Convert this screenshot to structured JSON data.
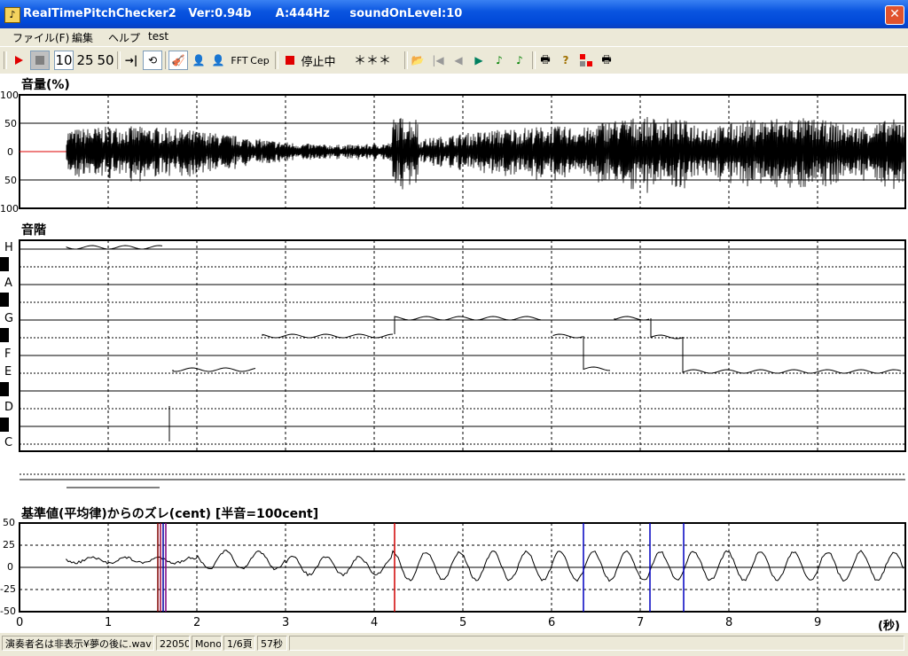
{
  "window": {
    "title": "RealTimePitchChecker2   Ver:0.94b      A:444Hz     soundOnLevel:10",
    "close_icon": "close-icon"
  },
  "menu": [
    "ファイル(F)",
    "編集",
    "ヘルプ",
    "test"
  ],
  "toolbar": {
    "play": "play-icon",
    "stop": "stop-icon",
    "speed_options": [
      "10",
      "25",
      "50"
    ],
    "fft_label": "FFT",
    "cep_label": "Cep",
    "status_label": "停止中",
    "note_display": "＊＊＊"
  },
  "volume_panel": {
    "title": "音量(%)",
    "y_labels": [
      "100",
      "50",
      "0",
      "50",
      "100"
    ]
  },
  "scale_panel": {
    "title": "音階",
    "note_labels": [
      "H",
      "A",
      "G",
      "F",
      "E",
      "D",
      "C"
    ]
  },
  "cent_panel": {
    "title": "基準値(平均律)からのズレ(cent) [半音=100cent]",
    "y_labels": [
      "50",
      "25",
      "0",
      "-25",
      "-50"
    ]
  },
  "time_axis": {
    "labels": [
      "0",
      "1",
      "2",
      "3",
      "4",
      "5",
      "6",
      "7",
      "8",
      "9"
    ],
    "unit": "(秒)"
  },
  "status_bar": [
    "演奏者名は非表示¥夢の後に.wav",
    "22050",
    "Mono",
    "1/6頁",
    "57秒"
  ]
}
